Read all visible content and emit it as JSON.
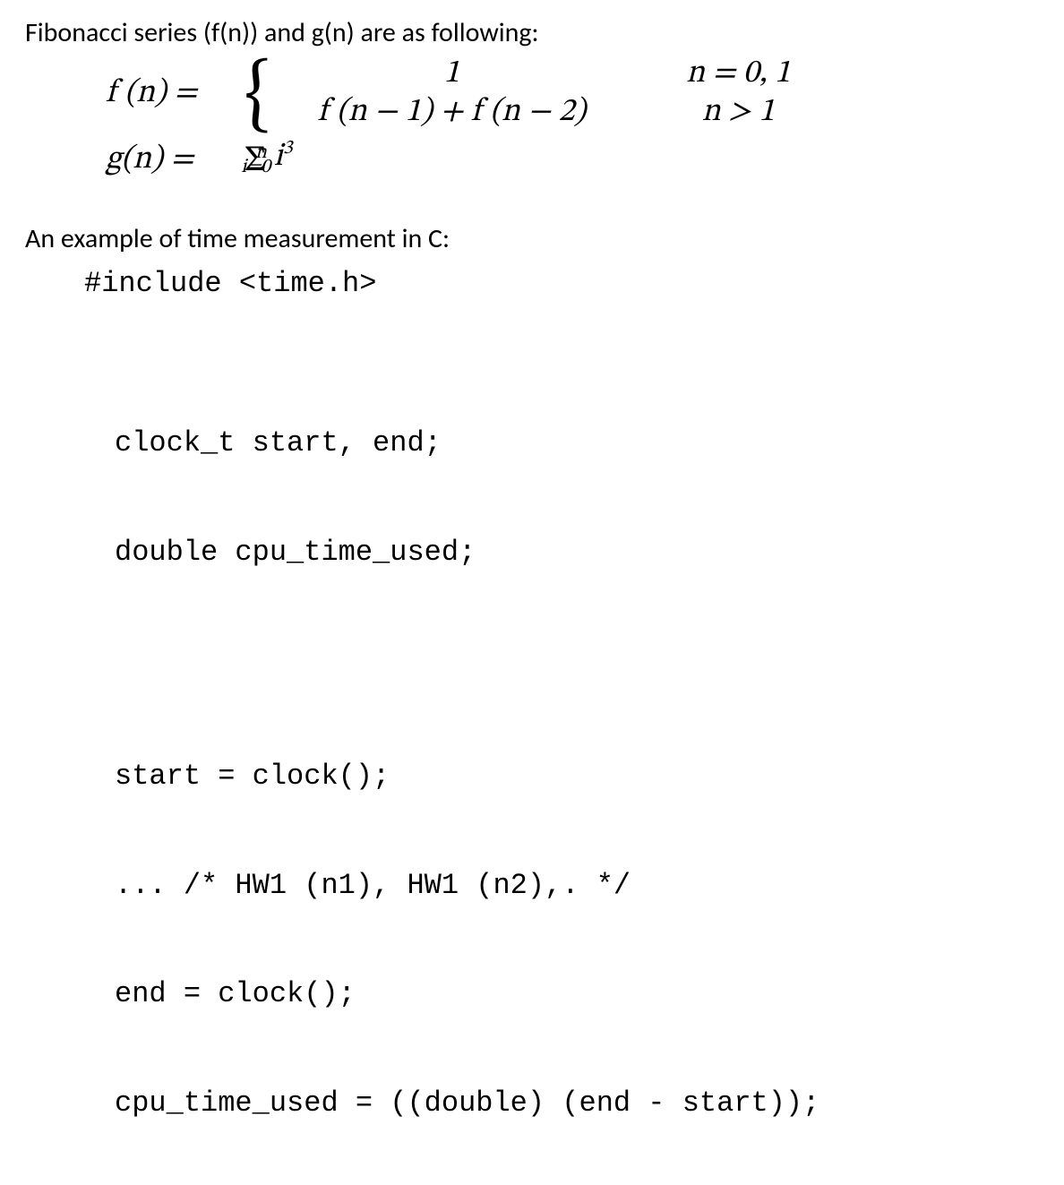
{
  "intro": "Fibonacci series (f(n)) and g(n) are as following:",
  "math": {
    "f_lhs": "f (n) = ",
    "case1_expr": "1",
    "case1_cond": "n = 0, 1",
    "case2_expr": "f (n − 1) + f (n − 2)",
    "case2_cond": "n > 1",
    "g_lhs": "g(n) = ",
    "g_rhs_sigma": "Σ",
    "g_rhs_upper": "n",
    "g_rhs_lower": "i=0",
    "g_rhs_body_i": " i",
    "g_rhs_body_exp": "3"
  },
  "prose2": "An example of time measurement in C:",
  "code": {
    "l1": "#include <time.h>",
    "l2": "clock_t start, end;",
    "l3": "double cpu_time_used;",
    "l4": "start = clock();",
    "l5": "... /* HW1 (n1), HW1 (n2),. */",
    "l6": "end = clock();",
    "l7": "cpu_time_used = ((double) (end - start));"
  }
}
